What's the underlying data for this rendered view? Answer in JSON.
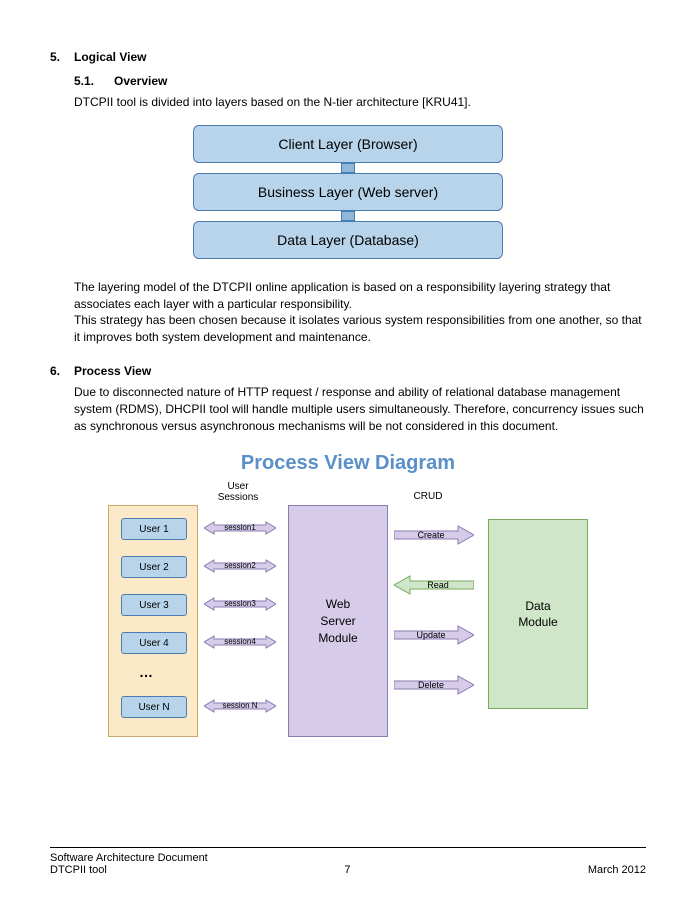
{
  "sec5": {
    "num": "5.",
    "title": "Logical View"
  },
  "sub51": {
    "num": "5.1.",
    "title": "Overview"
  },
  "intro5": "DTCPII tool is divided into layers based on the N-tier architecture [KRU41].",
  "layers": {
    "client": "Client Layer (Browser)",
    "business": "Business Layer (Web server)",
    "data": "Data Layer (Database)"
  },
  "para5a": "The layering model of the DTCPII online application is based on a responsibility layering strategy that associates each layer with a particular responsibility.",
  "para5b": "This strategy has been chosen because it isolates various system responsibilities from one another, so that it improves both system development and maintenance.",
  "sec6": {
    "num": "6.",
    "title": "Process View"
  },
  "para6": "Due to disconnected nature of HTTP request / response and ability of relational database management system (RDMS), DHCPII tool will handle multiple users simultaneously. Therefore, concurrency issues such as synchronous versus asynchronous mechanisms will be not considered in this document.",
  "pv": {
    "title": "Process View Diagram",
    "lbl_sessions": "User\nSessions",
    "lbl_crud": "CRUD",
    "users": [
      "User 1",
      "User 2",
      "User 3",
      "User 4",
      "User N"
    ],
    "dots": "…",
    "sessions": [
      "session1",
      "session2",
      "session3",
      "session4",
      "session N"
    ],
    "web": "Web\nServer\nModule",
    "crud": [
      "Create",
      "Read",
      "Update",
      "Delete"
    ],
    "dataMod": "Data\nModule"
  },
  "footer": {
    "doc": "Software Architecture Document",
    "tool": "DTCPII tool",
    "page": "7",
    "date": "March 2012"
  }
}
